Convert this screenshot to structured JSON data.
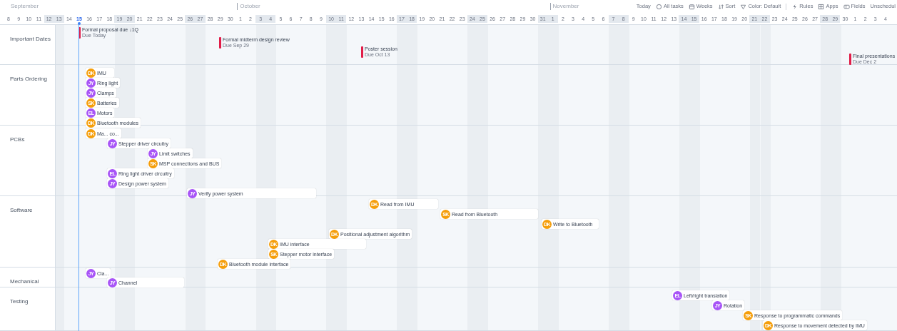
{
  "months": [
    "September",
    "October",
    "November"
  ],
  "toolbar": [
    {
      "label": "Today"
    },
    {
      "label": "All tasks"
    },
    {
      "label": "Weeks"
    },
    {
      "label": "Sort"
    },
    {
      "label": "Color: Default"
    },
    {
      "label": "Rules"
    },
    {
      "label": "Apps"
    },
    {
      "label": "Fields"
    },
    {
      "label": "Unschedul"
    }
  ],
  "days": [
    {
      "label": "8",
      "weekend": false,
      "today": false
    },
    {
      "label": "9",
      "weekend": false,
      "today": false
    },
    {
      "label": "10",
      "weekend": false,
      "today": false
    },
    {
      "label": "11",
      "weekend": false,
      "today": false
    },
    {
      "label": "12",
      "weekend": true,
      "today": false
    },
    {
      "label": "13",
      "weekend": true,
      "today": false
    },
    {
      "label": "14",
      "weekend": false,
      "today": false
    },
    {
      "label": "15",
      "weekend": false,
      "today": true
    },
    {
      "label": "16",
      "weekend": false,
      "today": false
    },
    {
      "label": "17",
      "weekend": false,
      "today": false
    },
    {
      "label": "18",
      "weekend": false,
      "today": false
    },
    {
      "label": "19",
      "weekend": true,
      "today": false
    },
    {
      "label": "20",
      "weekend": true,
      "today": false
    },
    {
      "label": "21",
      "weekend": false,
      "today": false
    },
    {
      "label": "22",
      "weekend": false,
      "today": false
    },
    {
      "label": "23",
      "weekend": false,
      "today": false
    },
    {
      "label": "24",
      "weekend": false,
      "today": false
    },
    {
      "label": "25",
      "weekend": false,
      "today": false
    },
    {
      "label": "26",
      "weekend": true,
      "today": false
    },
    {
      "label": "27",
      "weekend": true,
      "today": false
    },
    {
      "label": "28",
      "weekend": false,
      "today": false
    },
    {
      "label": "29",
      "weekend": false,
      "today": false
    },
    {
      "label": "30",
      "weekend": false,
      "today": false
    },
    {
      "label": "1",
      "weekend": false,
      "today": false
    },
    {
      "label": "2",
      "weekend": false,
      "today": false
    },
    {
      "label": "3",
      "weekend": true,
      "today": false
    },
    {
      "label": "4",
      "weekend": true,
      "today": false
    },
    {
      "label": "5",
      "weekend": false,
      "today": false
    },
    {
      "label": "6",
      "weekend": false,
      "today": false
    },
    {
      "label": "7",
      "weekend": false,
      "today": false
    },
    {
      "label": "8",
      "weekend": false,
      "today": false
    },
    {
      "label": "9",
      "weekend": false,
      "today": false
    },
    {
      "label": "10",
      "weekend": true,
      "today": false
    },
    {
      "label": "11",
      "weekend": true,
      "today": false
    },
    {
      "label": "12",
      "weekend": false,
      "today": false
    },
    {
      "label": "13",
      "weekend": false,
      "today": false
    },
    {
      "label": "14",
      "weekend": false,
      "today": false
    },
    {
      "label": "15",
      "weekend": false,
      "today": false
    },
    {
      "label": "16",
      "weekend": false,
      "today": false
    },
    {
      "label": "17",
      "weekend": true,
      "today": false
    },
    {
      "label": "18",
      "weekend": true,
      "today": false
    },
    {
      "label": "19",
      "weekend": false,
      "today": false
    },
    {
      "label": "20",
      "weekend": false,
      "today": false
    },
    {
      "label": "21",
      "weekend": false,
      "today": false
    },
    {
      "label": "22",
      "weekend": false,
      "today": false
    },
    {
      "label": "23",
      "weekend": false,
      "today": false
    },
    {
      "label": "24",
      "weekend": true,
      "today": false
    },
    {
      "label": "25",
      "weekend": true,
      "today": false
    },
    {
      "label": "26",
      "weekend": false,
      "today": false
    },
    {
      "label": "27",
      "weekend": false,
      "today": false
    },
    {
      "label": "28",
      "weekend": false,
      "today": false
    },
    {
      "label": "29",
      "weekend": false,
      "today": false
    },
    {
      "label": "30",
      "weekend": false,
      "today": false
    },
    {
      "label": "31",
      "weekend": true,
      "today": false
    },
    {
      "label": "1",
      "weekend": true,
      "today": false
    },
    {
      "label": "2",
      "weekend": false,
      "today": false
    },
    {
      "label": "3",
      "weekend": false,
      "today": false
    },
    {
      "label": "4",
      "weekend": false,
      "today": false
    },
    {
      "label": "5",
      "weekend": false,
      "today": false
    },
    {
      "label": "6",
      "weekend": false,
      "today": false
    },
    {
      "label": "7",
      "weekend": true,
      "today": false
    },
    {
      "label": "8",
      "weekend": true,
      "today": false
    },
    {
      "label": "9",
      "weekend": false,
      "today": false
    },
    {
      "label": "10",
      "weekend": false,
      "today": false
    },
    {
      "label": "11",
      "weekend": false,
      "today": false
    },
    {
      "label": "12",
      "weekend": false,
      "today": false
    },
    {
      "label": "13",
      "weekend": false,
      "today": false
    },
    {
      "label": "14",
      "weekend": true,
      "today": false
    },
    {
      "label": "15",
      "weekend": true,
      "today": false
    },
    {
      "label": "16",
      "weekend": false,
      "today": false
    },
    {
      "label": "17",
      "weekend": false,
      "today": false
    },
    {
      "label": "18",
      "weekend": false,
      "today": false
    },
    {
      "label": "19",
      "weekend": false,
      "today": false
    },
    {
      "label": "20",
      "weekend": false,
      "today": false
    },
    {
      "label": "21",
      "weekend": true,
      "today": false
    },
    {
      "label": "22",
      "weekend": true,
      "today": false
    },
    {
      "label": "23",
      "weekend": false,
      "today": false
    },
    {
      "label": "24",
      "weekend": false,
      "today": false
    },
    {
      "label": "25",
      "weekend": false,
      "today": false
    },
    {
      "label": "26",
      "weekend": false,
      "today": false
    },
    {
      "label": "27",
      "weekend": false,
      "today": false
    },
    {
      "label": "28",
      "weekend": true,
      "today": false
    },
    {
      "label": "29",
      "weekend": true,
      "today": false
    },
    {
      "label": "30",
      "weekend": false,
      "today": false
    },
    {
      "label": "1",
      "weekend": false,
      "today": false
    },
    {
      "label": "2",
      "weekend": false,
      "today": false
    },
    {
      "label": "3",
      "weekend": false,
      "today": false
    },
    {
      "label": "4",
      "weekend": false,
      "today": false
    }
  ],
  "groups": [
    {
      "name": "Important Dates",
      "items": [
        {
          "kind": "milestone",
          "title": "Formal proposal due ↓1Q",
          "due": "Due Today"
        },
        {
          "kind": "milestone",
          "title": "Formal midterm design review",
          "due": "Due Sep 29"
        },
        {
          "kind": "milestone",
          "title": "Poster session",
          "due": "Due Oct 13"
        },
        {
          "kind": "milestone",
          "title": "Final presentations",
          "due": "Due Dec 2"
        }
      ]
    },
    {
      "name": "Parts Ordering",
      "items": [
        {
          "kind": "task",
          "title": "IMU",
          "initials": "DK",
          "color": "#f59e0b"
        },
        {
          "kind": "task",
          "title": "Ring light",
          "initials": "JY",
          "color": "#a855f7"
        },
        {
          "kind": "task",
          "title": "Clamps",
          "initials": "JY",
          "color": "#a855f7"
        },
        {
          "kind": "task",
          "title": "Batteries",
          "initials": "SK",
          "color": "#f59e0b"
        },
        {
          "kind": "task",
          "title": "Motors",
          "initials": "EL",
          "color": "#a855f7"
        },
        {
          "kind": "task",
          "title": "Bluetooth modules",
          "initials": "DK",
          "color": "#f59e0b"
        }
      ]
    },
    {
      "name": "PCBs",
      "items": [
        {
          "kind": "task",
          "title": "Ma... co...",
          "initials": "DK",
          "color": "#f59e0b"
        },
        {
          "kind": "task",
          "title": "Stepper driver circuitry",
          "initials": "JY",
          "color": "#a855f7"
        },
        {
          "kind": "task",
          "title": "Limit switches",
          "initials": "JY",
          "color": "#a855f7"
        },
        {
          "kind": "task",
          "title": "MSP connections and BUS",
          "initials": "SK",
          "color": "#f59e0b"
        },
        {
          "kind": "task",
          "title": "Ring light driver circuitry",
          "initials": "EL",
          "color": "#a855f7"
        },
        {
          "kind": "task",
          "title": "Design power system",
          "initials": "JY",
          "color": "#a855f7"
        },
        {
          "kind": "task",
          "title": "Verify power system",
          "initials": "JY",
          "color": "#a855f7"
        }
      ]
    },
    {
      "name": "Software",
      "items": [
        {
          "kind": "task",
          "title": "Read from IMU",
          "initials": "DK",
          "color": "#f59e0b"
        },
        {
          "kind": "task",
          "title": "Read from Bluetooth",
          "initials": "SK",
          "color": "#f59e0b"
        },
        {
          "kind": "task",
          "title": "Write to Bluetooth",
          "initials": "DK",
          "color": "#f59e0b"
        },
        {
          "kind": "task",
          "title": "Positional adjustment algorithm",
          "initials": "DK",
          "color": "#f59e0b"
        },
        {
          "kind": "task",
          "title": "IMU interface",
          "initials": "DK",
          "color": "#f59e0b"
        },
        {
          "kind": "task",
          "title": "Stepper motor interface",
          "initials": "SK",
          "color": "#f59e0b"
        },
        {
          "kind": "task",
          "title": "Bluetooth module interface",
          "initials": "DK",
          "color": "#f59e0b"
        }
      ]
    },
    {
      "name": "Mechanical",
      "items": [
        {
          "kind": "task",
          "title": "Cla...",
          "initials": "JY",
          "color": "#a855f7"
        },
        {
          "kind": "task",
          "title": "Channel",
          "initials": "JY",
          "color": "#a855f7"
        }
      ]
    },
    {
      "name": "Testing",
      "items": [
        {
          "kind": "task",
          "title": "Left/right translation",
          "initials": "EL",
          "color": "#a855f7"
        },
        {
          "kind": "task",
          "title": "Rotation",
          "initials": "JY",
          "color": "#a855f7"
        },
        {
          "kind": "task",
          "title": "Response to programmatic commands",
          "initials": "SK",
          "color": "#f59e0b"
        },
        {
          "kind": "task",
          "title": "Response to movement detected by IMU",
          "initials": "DK",
          "color": "#f59e0b"
        }
      ]
    }
  ]
}
